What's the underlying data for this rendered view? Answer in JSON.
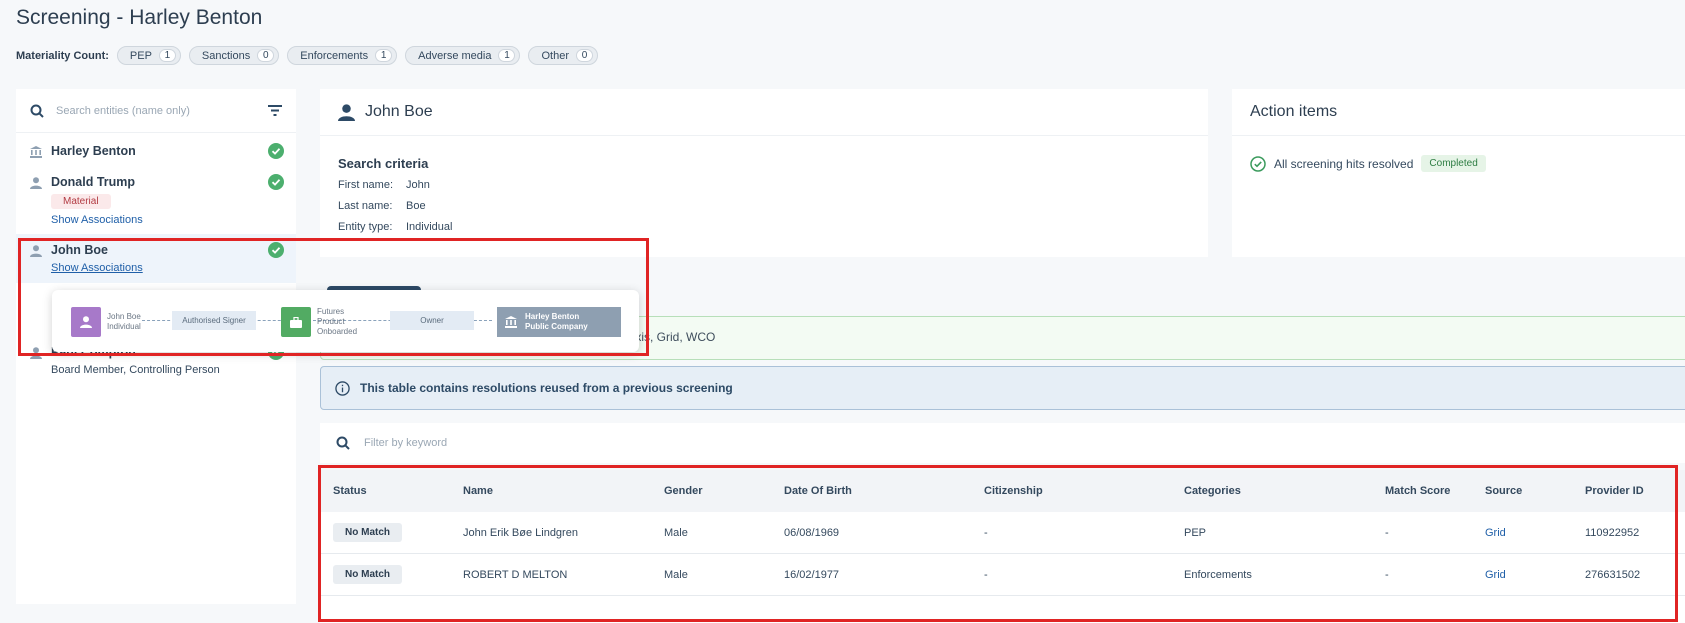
{
  "page": {
    "title": "Screening - Harley Benton"
  },
  "materiality": {
    "label": "Materiality Count:",
    "chips": [
      {
        "label": "PEP",
        "count": "1"
      },
      {
        "label": "Sanctions",
        "count": "0"
      },
      {
        "label": "Enforcements",
        "count": "1"
      },
      {
        "label": "Adverse media",
        "count": "1"
      },
      {
        "label": "Other",
        "count": "0"
      }
    ]
  },
  "sidebar": {
    "search_placeholder": "Search entities (name only)",
    "entities": [
      {
        "name": "Harley Benton"
      },
      {
        "name": "Donald Trump",
        "badge": "Material",
        "link": "Show Associations"
      },
      {
        "name": "John Boe",
        "link": "Show Associations"
      },
      {
        "name": "Paul Compton",
        "sub": "Board Member, Controlling Person"
      }
    ]
  },
  "popup": {
    "person": {
      "name": "John Boe",
      "type": "Individual"
    },
    "edge1": "Authorised Signer",
    "product": {
      "name": "Futures",
      "type": "Product",
      "status": "Onboarded"
    },
    "edge2": "Owner",
    "company": {
      "name": "Harley Benton",
      "type": "Public Company"
    }
  },
  "entity_card": {
    "name": "John Boe",
    "criteria_title": "Search criteria",
    "rows": [
      {
        "k": "First name:",
        "v": "John"
      },
      {
        "k": "Last name:",
        "v": "Boe"
      },
      {
        "k": "Entity type:",
        "v": "Individual"
      }
    ]
  },
  "actions": {
    "title": "Action items",
    "item": "All screening hits resolved",
    "status": "Completed"
  },
  "banners": {
    "sources": "lexis, Grid, WCO",
    "reuse": "This table contains resolutions reused from a previous screening"
  },
  "filter": {
    "placeholder": "Filter by keyword"
  },
  "table": {
    "headers": [
      "Status",
      "Name",
      "Gender",
      "Date Of Birth",
      "Citizenship",
      "Categories",
      "Match Score",
      "Source",
      "Provider ID"
    ],
    "rows": [
      {
        "status": "No Match",
        "name": "John Erik Bøe Lindgren",
        "gender": "Male",
        "dob": "06/08/1969",
        "citizenship": "-",
        "categories": "PEP",
        "score": "-",
        "source": "Grid",
        "provider": "110922952"
      },
      {
        "status": "No Match",
        "name": "ROBERT D MELTON",
        "gender": "Male",
        "dob": "16/02/1977",
        "citizenship": "-",
        "categories": "Enforcements",
        "score": "-",
        "source": "Grid",
        "provider": "276631502"
      }
    ]
  },
  "colors": {
    "highlight": "#e02424",
    "success": "#4caf6e",
    "link": "#1f5fa8",
    "material": "#b23b43"
  }
}
